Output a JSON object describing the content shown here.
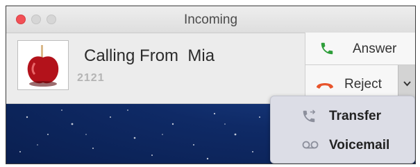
{
  "window": {
    "title": "Incoming",
    "controls": [
      "close-button",
      "minimize-button",
      "zoom-button"
    ]
  },
  "caller": {
    "name_line": "Calling From  Mia",
    "number": "2121",
    "avatar": "apple-icon"
  },
  "actions": {
    "answer_label": "Answer",
    "answer_icon": "phone-icon",
    "reject_label": "Reject",
    "reject_icon": "hangup-icon",
    "more_icon": "chevron-down-icon"
  },
  "menu": {
    "items": [
      {
        "label": "Transfer",
        "icon": "transfer-icon"
      },
      {
        "label": "Voicemail",
        "icon": "voicemail-icon"
      }
    ]
  },
  "colors": {
    "close": "#f25056",
    "answer_green": "#2e9e3a",
    "reject_orange": "#e8542b",
    "desktop": "#0f2a66"
  }
}
